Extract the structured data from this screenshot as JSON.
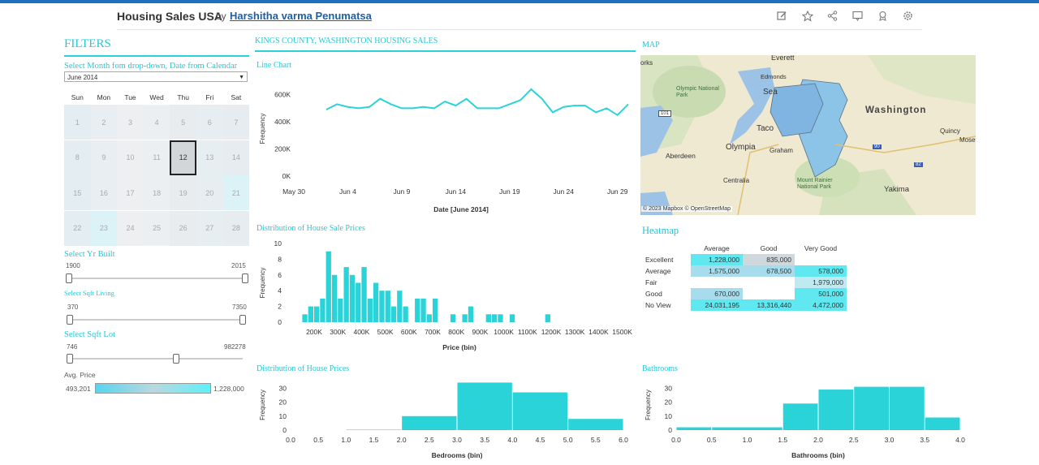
{
  "header": {
    "title": "Housing Sales USA",
    "by": "by",
    "author": "Harshitha varma Penumatsa",
    "icons": [
      "edit-icon",
      "star-icon",
      "share-icon",
      "comment-icon",
      "subscribe-icon",
      "settings-icon"
    ]
  },
  "filters": {
    "title": "FILTERS",
    "month_label": "Select Month fom drop-down, Date from Calendar",
    "month_value": "June 2014",
    "weekdays": [
      "Sun",
      "Mon",
      "Tue",
      "Wed",
      "Thu",
      "Fri",
      "Sat"
    ],
    "days": [
      "1",
      "2",
      "3",
      "4",
      "5",
      "6",
      "7",
      "8",
      "9",
      "10",
      "11",
      "12",
      "13",
      "14",
      "15",
      "16",
      "17",
      "18",
      "19",
      "20",
      "21",
      "22",
      "23",
      "24",
      "25",
      "26",
      "27",
      "28"
    ],
    "selected_day": "12",
    "yr_built": {
      "label": "Select Yr Built",
      "min": "1900",
      "max": "2015"
    },
    "sqft_living": {
      "label": "Select Sqft Living",
      "min": "370",
      "max": "7350"
    },
    "sqft_lot": {
      "label": "Select Sqft Lot",
      "min": "746",
      "max": "982278",
      "handle_fraction": 0.5
    },
    "avg_price": {
      "label": "Avg. Price",
      "min": "493,201",
      "max": "1,228,000"
    }
  },
  "main": {
    "section_title": "KINGS COUNTY, WASHINGTON HOUSING SALES",
    "map_title": "MAP",
    "heatmap_title": "Heatmap"
  },
  "map": {
    "labels": [
      "orks",
      "Everett",
      "Edmonds",
      "Olympic National Park",
      "Sea",
      "Washington",
      "Quincy",
      "Mose",
      "Taco",
      "Olympia",
      "Graham",
      "Aberdeen",
      "Centralia",
      "Mount Rainier National Park",
      "Yakima",
      "101",
      "90",
      "82"
    ],
    "attribution": "© 2023 Mapbox  © OpenStreetMap"
  },
  "heatmap": {
    "columns": [
      "Average",
      "Good",
      "Very Good"
    ],
    "rows": [
      {
        "label": "Excellent",
        "values": [
          "1,228,000",
          "835,000",
          ""
        ]
      },
      {
        "label": "Average",
        "values": [
          "1,575,000",
          "678,500",
          "578,000"
        ]
      },
      {
        "label": "Fair",
        "values": [
          "",
          "",
          "1,979,000"
        ]
      },
      {
        "label": "Good",
        "values": [
          "670,000",
          "",
          "501,000"
        ]
      },
      {
        "label": "No View",
        "values": [
          "24,031,195",
          "13,316,440",
          "4,472,000"
        ]
      }
    ],
    "colors": [
      [
        "#5fe8f0",
        "#cfd8dc",
        ""
      ],
      [
        "#a6dcec",
        "#a6dcec",
        "#5fe8f0"
      ],
      [
        "",
        "",
        "#bfeaf2"
      ],
      [
        "#a6dcec",
        "",
        "#5fe8f0"
      ],
      [
        "#5fe8f0",
        "#5fe8f0",
        "#5fe8f0"
      ]
    ]
  },
  "chart_data": [
    {
      "type": "line",
      "title": "Line Chart",
      "xlabel": "Date [June 2014]",
      "ylabel": "Frequency",
      "x_ticks": [
        "May 30",
        "Jun 4",
        "Jun 9",
        "Jun 14",
        "Jun 19",
        "Jun 24",
        "Jun 29"
      ],
      "y_ticks": [
        "0K",
        "200K",
        "400K",
        "600K"
      ],
      "ylim": [
        0,
        700000
      ],
      "x": [
        "2014-06-02",
        "2014-06-03",
        "2014-06-04",
        "2014-06-05",
        "2014-06-06",
        "2014-06-07",
        "2014-06-08",
        "2014-06-09",
        "2014-06-10",
        "2014-06-11",
        "2014-06-12",
        "2014-06-13",
        "2014-06-14",
        "2014-06-15",
        "2014-06-16",
        "2014-06-17",
        "2014-06-18",
        "2014-06-19",
        "2014-06-20",
        "2014-06-21",
        "2014-06-22",
        "2014-06-23",
        "2014-06-24",
        "2014-06-25",
        "2014-06-26",
        "2014-06-27",
        "2014-06-28",
        "2014-06-29",
        "2014-06-30"
      ],
      "values": [
        490000,
        530000,
        510000,
        500000,
        510000,
        570000,
        530000,
        500000,
        500000,
        510000,
        500000,
        550000,
        520000,
        570000,
        500000,
        500000,
        500000,
        530000,
        560000,
        640000,
        570000,
        470000,
        510000,
        520000,
        520000,
        470000,
        500000,
        450000,
        530000
      ],
      "color": "#2ad3d8"
    },
    {
      "type": "bar",
      "title": "Distribution of House Sale Prices",
      "xlabel": "Price (bin)",
      "ylabel": "Frequency",
      "x_ticks": [
        "200K",
        "300K",
        "400K",
        "500K",
        "600K",
        "700K",
        "800K",
        "900K",
        "1000K",
        "1100K",
        "1200K",
        "1300K",
        "1400K",
        "1500K"
      ],
      "y_ticks": [
        "0",
        "2",
        "4",
        "6",
        "8",
        "10"
      ],
      "ylim": [
        0,
        10
      ],
      "bin_start": 150000,
      "bin_width": 25000,
      "values": [
        1,
        2,
        2,
        3,
        9,
        6,
        3,
        7,
        6,
        5,
        7,
        3,
        5,
        4,
        4,
        2,
        4,
        2,
        0,
        3,
        3,
        1,
        3,
        0,
        0,
        1,
        0,
        1,
        2,
        0,
        0,
        1,
        1,
        1,
        0,
        1,
        0,
        0,
        0,
        0,
        0,
        1
      ],
      "color": "#2ad3d8"
    },
    {
      "type": "bar",
      "title": "Distribution of House Prices",
      "xlabel": "Bedrooms (bin)",
      "ylabel": "Frequency",
      "x_ticks": [
        "0.0",
        "0.5",
        "1.0",
        "1.5",
        "2.0",
        "2.5",
        "3.0",
        "3.5",
        "4.0",
        "4.5",
        "5.0",
        "5.5",
        "6.0"
      ],
      "y_ticks": [
        "0",
        "10",
        "20",
        "30"
      ],
      "ylim": [
        0,
        36
      ],
      "bins": [
        [
          0,
          1
        ],
        [
          1,
          2
        ],
        [
          2,
          3
        ],
        [
          3,
          4
        ],
        [
          4,
          5
        ],
        [
          5,
          6
        ]
      ],
      "values": [
        0,
        0.3,
        10,
        34,
        27,
        8
      ],
      "color": "#2ad3d8"
    },
    {
      "type": "bar",
      "title": "Bathrooms",
      "xlabel": "Bathrooms (bin)",
      "ylabel": "Frequency",
      "x_ticks": [
        "0.0",
        "0.5",
        "1.0",
        "1.5",
        "2.0",
        "2.5",
        "3.0",
        "3.5",
        "4.0"
      ],
      "y_ticks": [
        "0",
        "10",
        "20",
        "30"
      ],
      "ylim": [
        0,
        36
      ],
      "bins": [
        [
          0,
          0.5
        ],
        [
          0.5,
          1.5
        ],
        [
          1.5,
          2.0
        ],
        [
          2.0,
          2.5
        ],
        [
          2.5,
          3.0
        ],
        [
          3.0,
          3.5
        ],
        [
          3.5,
          4.0
        ]
      ],
      "values": [
        2,
        2,
        19,
        29,
        31,
        31,
        9
      ],
      "color": "#2ad3d8"
    }
  ]
}
